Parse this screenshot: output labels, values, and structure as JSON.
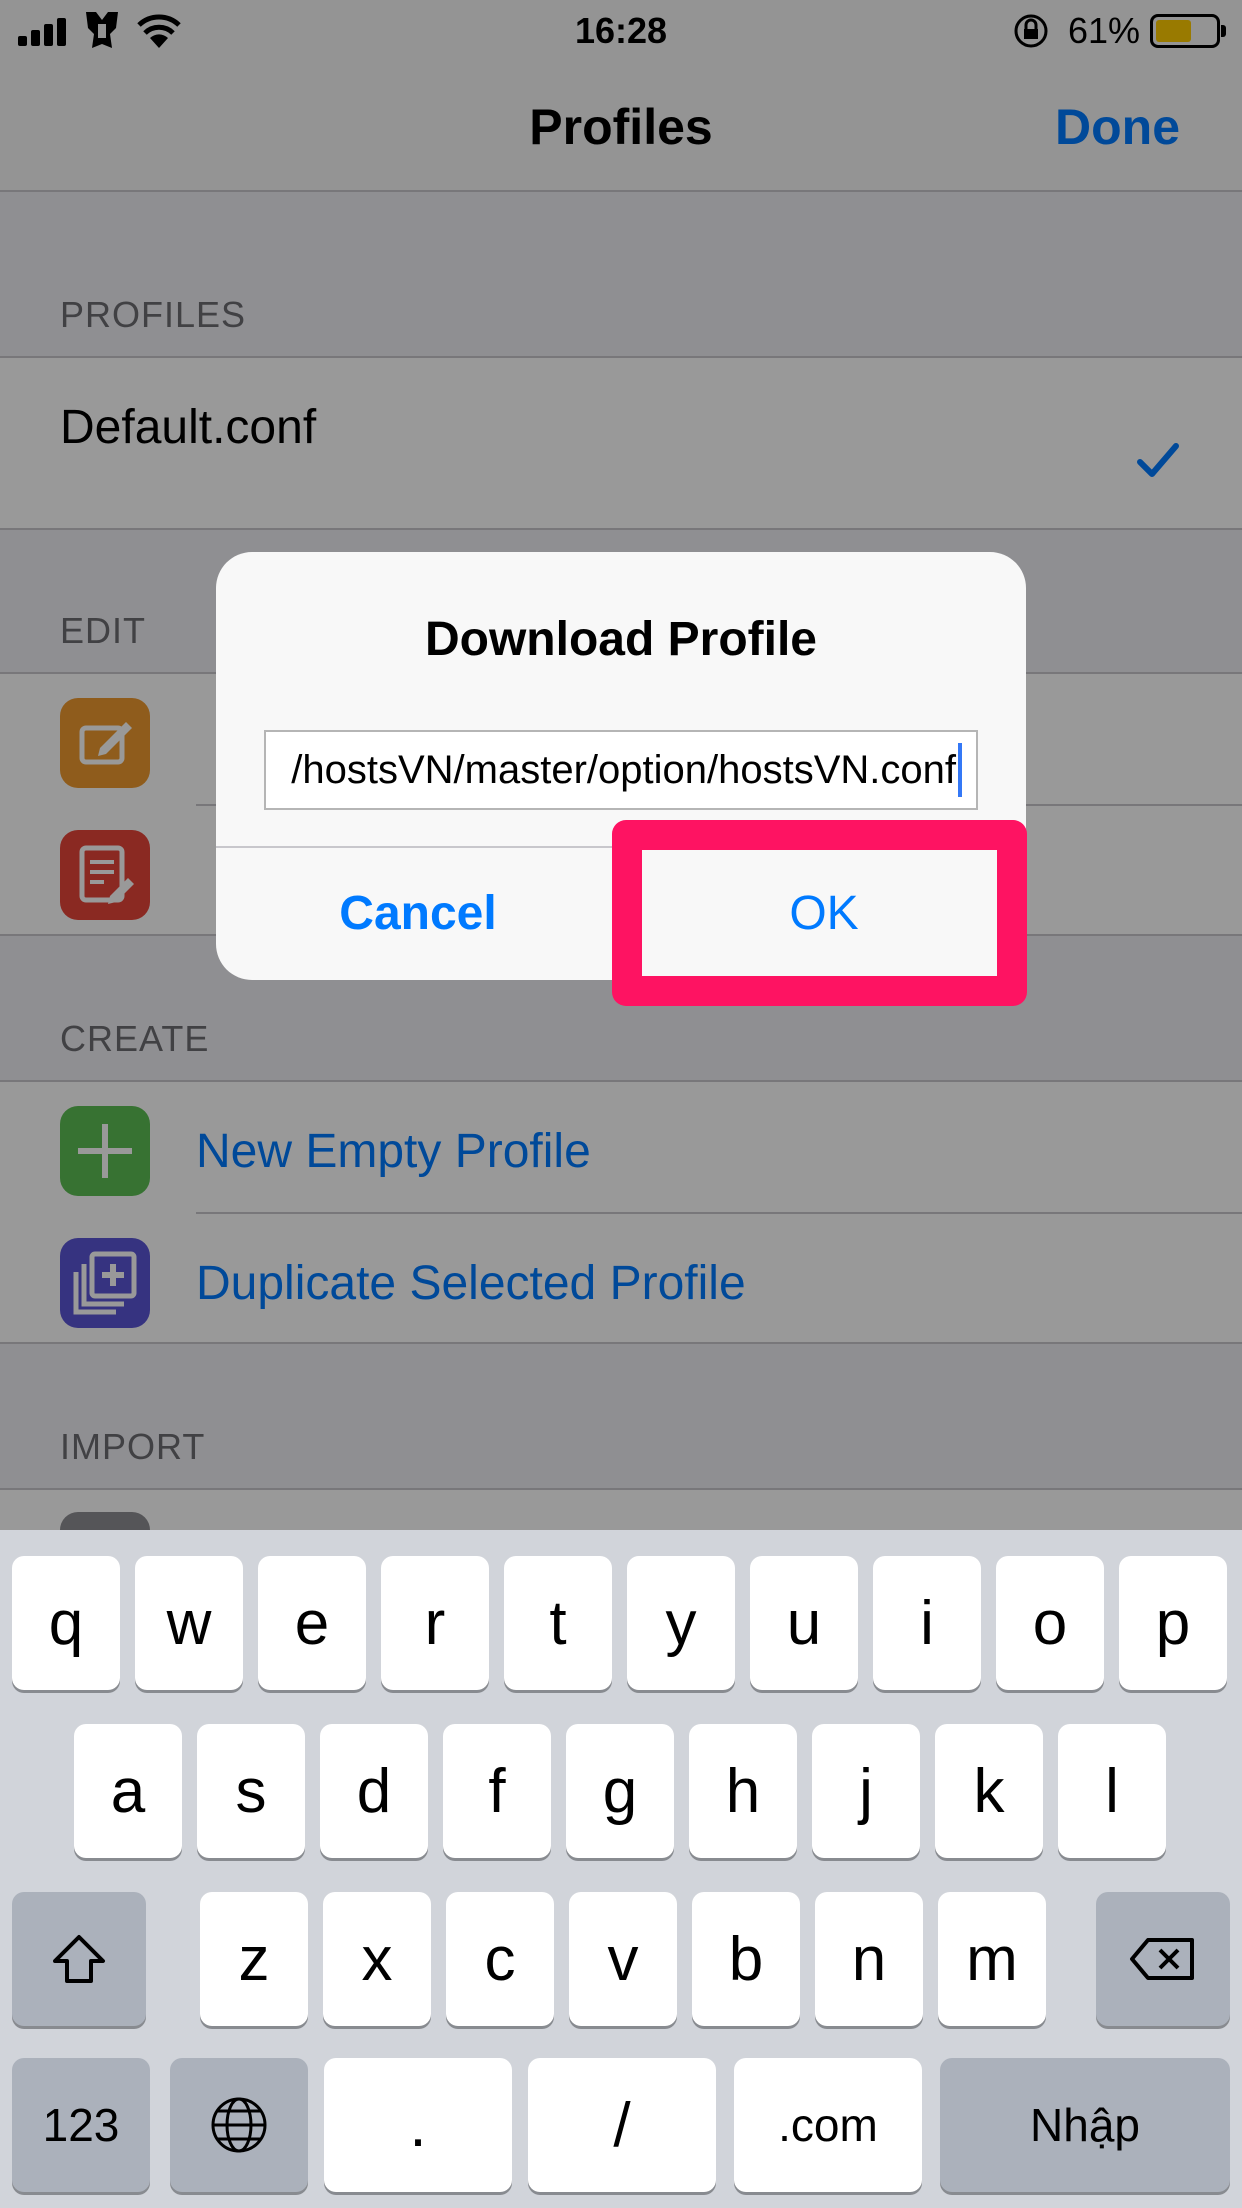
{
  "status_bar": {
    "time": "16:28",
    "battery_percent": "61%",
    "battery_level": 0.61
  },
  "nav": {
    "title": "Profiles",
    "done_label": "Done"
  },
  "sections": {
    "profiles": {
      "header": "PROFILES",
      "items": [
        "Default.conf"
      ]
    },
    "edit": {
      "header": "EDIT"
    },
    "create": {
      "header": "CREATE",
      "items": [
        "New Empty Profile",
        "Duplicate Selected Profile"
      ]
    },
    "import": {
      "header": "IMPORT"
    }
  },
  "alert": {
    "title": "Download Profile",
    "input_value": "/hostsVN/master/option/hostsVN.conf",
    "cancel_label": "Cancel",
    "ok_label": "OK"
  },
  "keyboard": {
    "row1": [
      "q",
      "w",
      "e",
      "r",
      "t",
      "y",
      "u",
      "i",
      "o",
      "p"
    ],
    "row2": [
      "a",
      "s",
      "d",
      "f",
      "g",
      "h",
      "j",
      "k",
      "l"
    ],
    "row3": [
      "z",
      "x",
      "c",
      "v",
      "b",
      "n",
      "m"
    ],
    "numbers_label": "123",
    "dot_label": ".",
    "slash_label": "/",
    "dotcom_label": ".com",
    "return_label": "Nhập"
  },
  "colors": {
    "accent": "#007aff",
    "highlight": "#fe1362",
    "edit_icon_1": "#ef9a2f",
    "edit_icon_2": "#e7453a",
    "create_icon_1": "#5cbf54",
    "create_icon_2": "#5b55d6"
  }
}
